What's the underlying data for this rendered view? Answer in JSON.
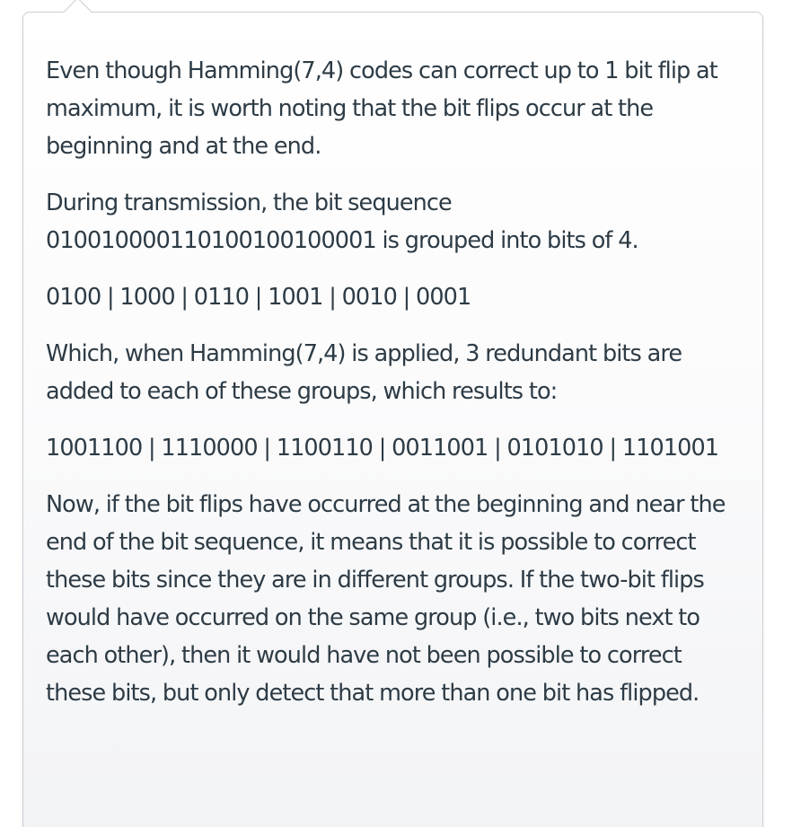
{
  "answer": {
    "paragraphs": [
      "Even though Hamming(7,4) codes can correct up to 1 bit flip at maximum, it is worth noting that the bit flips occur at the beginning and at the end.",
      "During transmission, the bit sequence 010010000110100100100001 is grouped into bits of 4.",
      "0100 | 1000 | 0110 | 1001 | 0010 | 0001",
      "Which, when Hamming(7,4) is applied, 3 redundant bits are added to each of these groups, which results to:",
      "1001100 | 1110000 | 1100110 | 0011001 | 0101010 | 1101001",
      "Now, if the bit flips have occurred at the beginning and near the end of the bit sequence, it means that it is possible to correct these bits since they are in different groups. If the two-bit flips would have occurred on the same group (i.e., two bits next to each other), then it would have not been possible to correct these bits, but only detect that more than one bit has flipped."
    ]
  }
}
